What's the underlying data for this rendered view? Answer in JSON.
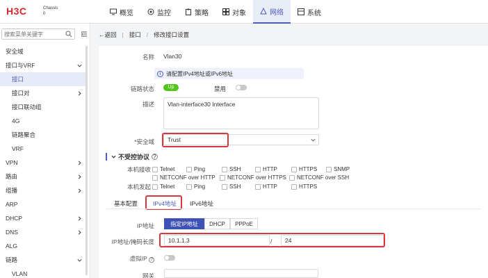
{
  "header": {
    "logo": "H3C",
    "logo_sub_1": "Chassis",
    "logo_sub_2": "0",
    "nav": [
      {
        "label": "概览",
        "icon": "monitor-icon"
      },
      {
        "label": "监控",
        "icon": "eye-icon"
      },
      {
        "label": "策略",
        "icon": "clipboard-icon"
      },
      {
        "label": "对象",
        "icon": "grid-icon"
      },
      {
        "label": "网络",
        "icon": "network-icon",
        "active": true
      },
      {
        "label": "系统",
        "icon": "system-icon"
      }
    ]
  },
  "sidebar": {
    "search_placeholder": "搜索菜单关键字",
    "items": [
      {
        "label": "安全域"
      },
      {
        "label": "接口与VRF",
        "expanded": true
      },
      {
        "label": "接口",
        "active": true
      },
      {
        "label": "接口对"
      },
      {
        "label": "接口联动组"
      },
      {
        "label": "4G"
      },
      {
        "label": "链路聚合"
      },
      {
        "label": "VRF"
      },
      {
        "label": "VPN"
      },
      {
        "label": "路由"
      },
      {
        "label": "组播"
      },
      {
        "label": "ARP"
      },
      {
        "label": "DHCP"
      },
      {
        "label": "DNS"
      },
      {
        "label": "ALG"
      },
      {
        "label": "链路",
        "expanded": true
      },
      {
        "label": "VLAN"
      }
    ]
  },
  "breadcrumb": {
    "back": "返回",
    "item1": "接口",
    "sep": "/",
    "item2": "修改接口设置"
  },
  "form": {
    "name_label": "名称",
    "name_value": "Vlan30",
    "hint": "请配置IPv4地址或IPv6地址",
    "link_status_label": "链路状态",
    "link_status_value": "Up",
    "disable_label": "禁用",
    "desc_label": "描述",
    "desc_value": "Vlan-interface30 Interface",
    "zone_label": "*安全域",
    "zone_value": "Trust",
    "section_title": "不受控协议",
    "local_recv_label": "本机接收",
    "local_send_label": "本机发起",
    "recv_protocols": [
      "Telnet",
      "Ping",
      "SSH",
      "HTTP",
      "HTTPS",
      "SNMP",
      "NETCONF over HTTP",
      "NETCONF over HTTPS",
      "NETCONF over SSH"
    ],
    "send_protocols": [
      "Telnet",
      "Ping",
      "SSH",
      "HTTP",
      "HTTPS"
    ],
    "tabs": {
      "basic": "基本配置",
      "ipv4": "IPv4地址",
      "ipv6": "IPv6地址"
    },
    "ip_label": "IP地址",
    "ip_modes": [
      "指定IP地址",
      "DHCP",
      "PPPoE"
    ],
    "ip_mask_label": "IP地址/掩码长度",
    "ip_value": "10.1.1.3",
    "slash": "/",
    "mask_value": "24",
    "virtual_ip_label": "虚拟IP",
    "gateway_label": "网关"
  }
}
